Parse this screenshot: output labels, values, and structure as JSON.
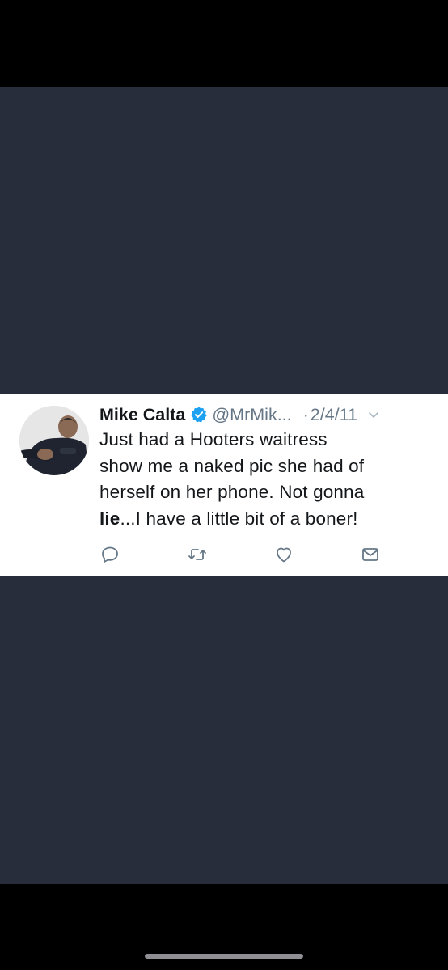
{
  "tweet": {
    "author_name": "Mike Calta",
    "handle": "@MrMik...",
    "separator": "·",
    "date": "2/4/11",
    "text_line1": "Just had a Hooters waitress",
    "text_line2": "show me a naked pic she had of",
    "text_line3": "herself on her phone. Not gonna",
    "text_line4_bold": "lie",
    "text_line4_rest": "...I have a little bit of a boner!"
  },
  "icons": {
    "verified": "verified-badge-icon",
    "menu": "chevron-down-icon",
    "reply": "reply-icon",
    "retweet": "retweet-icon",
    "like": "heart-icon",
    "message": "envelope-icon"
  },
  "colors": {
    "background_dark": "#282d3b",
    "card": "#ffffff",
    "verified": "#1da1f2",
    "muted": "#657786",
    "text": "#14171a"
  }
}
